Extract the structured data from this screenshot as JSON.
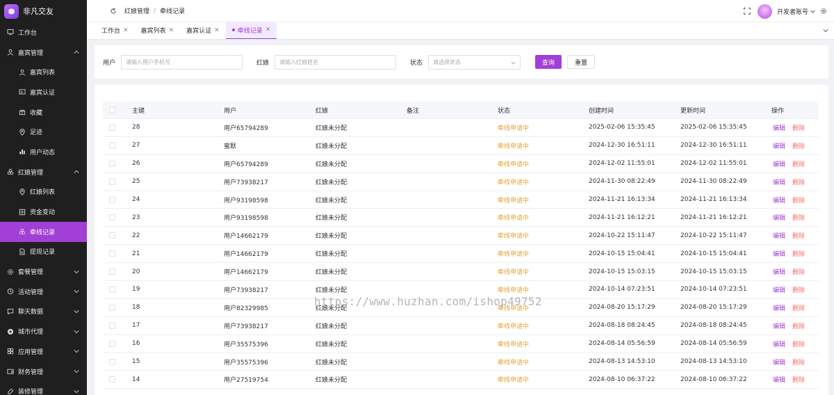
{
  "app": {
    "name": "非凡交友"
  },
  "sidebar": {
    "items": [
      {
        "label": "工作台",
        "icon": "monitor-icon",
        "level": "top"
      },
      {
        "label": "嘉宾管理",
        "icon": "user-icon",
        "level": "top",
        "expand": "up"
      },
      {
        "label": "嘉宾列表",
        "icon": "user-icon",
        "level": "sub"
      },
      {
        "label": "嘉宾认证",
        "icon": "id-card-icon",
        "level": "sub"
      },
      {
        "label": "收藏",
        "icon": "gift-icon",
        "level": "sub"
      },
      {
        "label": "足迹",
        "icon": "location-icon",
        "level": "sub"
      },
      {
        "label": "用户动态",
        "icon": "bar-chart-icon",
        "level": "sub"
      },
      {
        "label": "红娘管理",
        "icon": "link-icon",
        "level": "top",
        "expand": "up"
      },
      {
        "label": "红娘列表",
        "icon": "location-icon",
        "level": "sub"
      },
      {
        "label": "资金变动",
        "icon": "grid-icon",
        "level": "sub"
      },
      {
        "label": "牵线记录",
        "icon": "link-icon",
        "level": "sub",
        "active": true
      },
      {
        "label": "提现记录",
        "icon": "file-icon",
        "level": "sub"
      },
      {
        "label": "套餐管理",
        "icon": "settings-icon",
        "level": "top",
        "expand": "down"
      },
      {
        "label": "活动管理",
        "icon": "activity-icon",
        "level": "top",
        "expand": "down"
      },
      {
        "label": "聊天数据",
        "icon": "chat-icon",
        "level": "top",
        "expand": "down"
      },
      {
        "label": "城市代理",
        "icon": "plus-circle-icon",
        "level": "top",
        "expand": "down"
      },
      {
        "label": "应用管理",
        "icon": "apps-icon",
        "level": "top",
        "expand": "down"
      },
      {
        "label": "财务管理",
        "icon": "wallet-icon",
        "level": "top",
        "expand": "down"
      },
      {
        "label": "装修管理",
        "icon": "brush-icon",
        "level": "top",
        "expand": "down"
      }
    ]
  },
  "header": {
    "breadcrumb": [
      "红娘管理",
      "牵线记录"
    ],
    "account": "开发者账号"
  },
  "tabs": [
    {
      "label": "工作台",
      "active": false
    },
    {
      "label": "嘉宾列表",
      "active": false
    },
    {
      "label": "嘉宾认证",
      "active": false
    },
    {
      "label": "牵线记录",
      "active": true
    }
  ],
  "filter": {
    "user_label": "用户",
    "user_placeholder": "请输入用户手机号",
    "matchmaker_label": "红娘",
    "matchmaker_placeholder": "请输入红娘姓名",
    "status_label": "状态",
    "status_placeholder": "请选择状态",
    "query_label": "查询",
    "reset_label": "重置"
  },
  "table": {
    "columns": [
      "主键",
      "用户",
      "红娘",
      "备注",
      "状态",
      "创建时间",
      "更新时间",
      "操作"
    ],
    "edit_label": "编辑",
    "delete_label": "删除",
    "rows": [
      {
        "id": "28",
        "user": "用户65794289",
        "matchmaker": "红娘未分配",
        "note": "",
        "status": "牵线申请中",
        "created": "2025-02-06 15:35:45",
        "updated": "2025-02-06 15:35:45"
      },
      {
        "id": "27",
        "user": "蜜默",
        "matchmaker": "红娘未分配",
        "note": "",
        "status": "牵线申请中",
        "created": "2024-12-30 16:51:11",
        "updated": "2024-12-30 16:51:11"
      },
      {
        "id": "26",
        "user": "用户65794289",
        "matchmaker": "红娘未分配",
        "note": "",
        "status": "牵线申请中",
        "created": "2024-12-02 11:55:01",
        "updated": "2024-12-02 11:55:01"
      },
      {
        "id": "25",
        "user": "用户73938217",
        "matchmaker": "红娘未分配",
        "note": "",
        "status": "牵线申请中",
        "created": "2024-11-30 08:22:49",
        "updated": "2024-11-30 08:22:49"
      },
      {
        "id": "24",
        "user": "用户93198598",
        "matchmaker": "红娘未分配",
        "note": "",
        "status": "牵线申请中",
        "created": "2024-11-21 16:13:34",
        "updated": "2024-11-21 16:13:34"
      },
      {
        "id": "23",
        "user": "用户93198598",
        "matchmaker": "红娘未分配",
        "note": "",
        "status": "牵线申请中",
        "created": "2024-11-21 16:12:21",
        "updated": "2024-11-21 16:12:21"
      },
      {
        "id": "22",
        "user": "用户14662179",
        "matchmaker": "红娘未分配",
        "note": "",
        "status": "牵线申请中",
        "created": "2024-10-22 15:11:47",
        "updated": "2024-10-22 15:11:47"
      },
      {
        "id": "21",
        "user": "用户14662179",
        "matchmaker": "红娘未分配",
        "note": "",
        "status": "牵线申请中",
        "created": "2024-10-15 15:04:41",
        "updated": "2024-10-15 15:04:41"
      },
      {
        "id": "20",
        "user": "用户14662179",
        "matchmaker": "红娘未分配",
        "note": "",
        "status": "牵线申请中",
        "created": "2024-10-15 15:03:15",
        "updated": "2024-10-15 15:03:15"
      },
      {
        "id": "19",
        "user": "用户73938217",
        "matchmaker": "红娘未分配",
        "note": "",
        "status": "牵线申请中",
        "created": "2024-10-14 07:23:51",
        "updated": "2024-10-14 07:23:51"
      },
      {
        "id": "18",
        "user": "用户82329985",
        "matchmaker": "红娘未分配",
        "note": "",
        "status": "牵线申请中",
        "created": "2024-08-20 15:17:29",
        "updated": "2024-08-20 15:17:29"
      },
      {
        "id": "17",
        "user": "用户73938217",
        "matchmaker": "红娘未分配",
        "note": "",
        "status": "牵线申请中",
        "created": "2024-08-18 08:24:45",
        "updated": "2024-08-18 08:24:45"
      },
      {
        "id": "16",
        "user": "用户35575396",
        "matchmaker": "红娘未分配",
        "note": "",
        "status": "牵线申请中",
        "created": "2024-08-14 05:56:59",
        "updated": "2024-08-14 05:56:59"
      },
      {
        "id": "15",
        "user": "用户35575396",
        "matchmaker": "红娘未分配",
        "note": "",
        "status": "牵线申请中",
        "created": "2024-08-13 14:53:10",
        "updated": "2024-08-13 14:53:10"
      },
      {
        "id": "14",
        "user": "用户27519754",
        "matchmaker": "红娘未分配",
        "note": "",
        "status": "牵线申请中",
        "created": "2024-08-10 06:37:22",
        "updated": "2024-08-10 06:37:22"
      }
    ]
  },
  "watermark": "https://www.huzhan.com/ishop49752",
  "colors": {
    "accent": "#a23fd6",
    "status": "#e6a23c",
    "danger": "#f56c6c",
    "sidebar_bg": "#1f1f1f"
  }
}
